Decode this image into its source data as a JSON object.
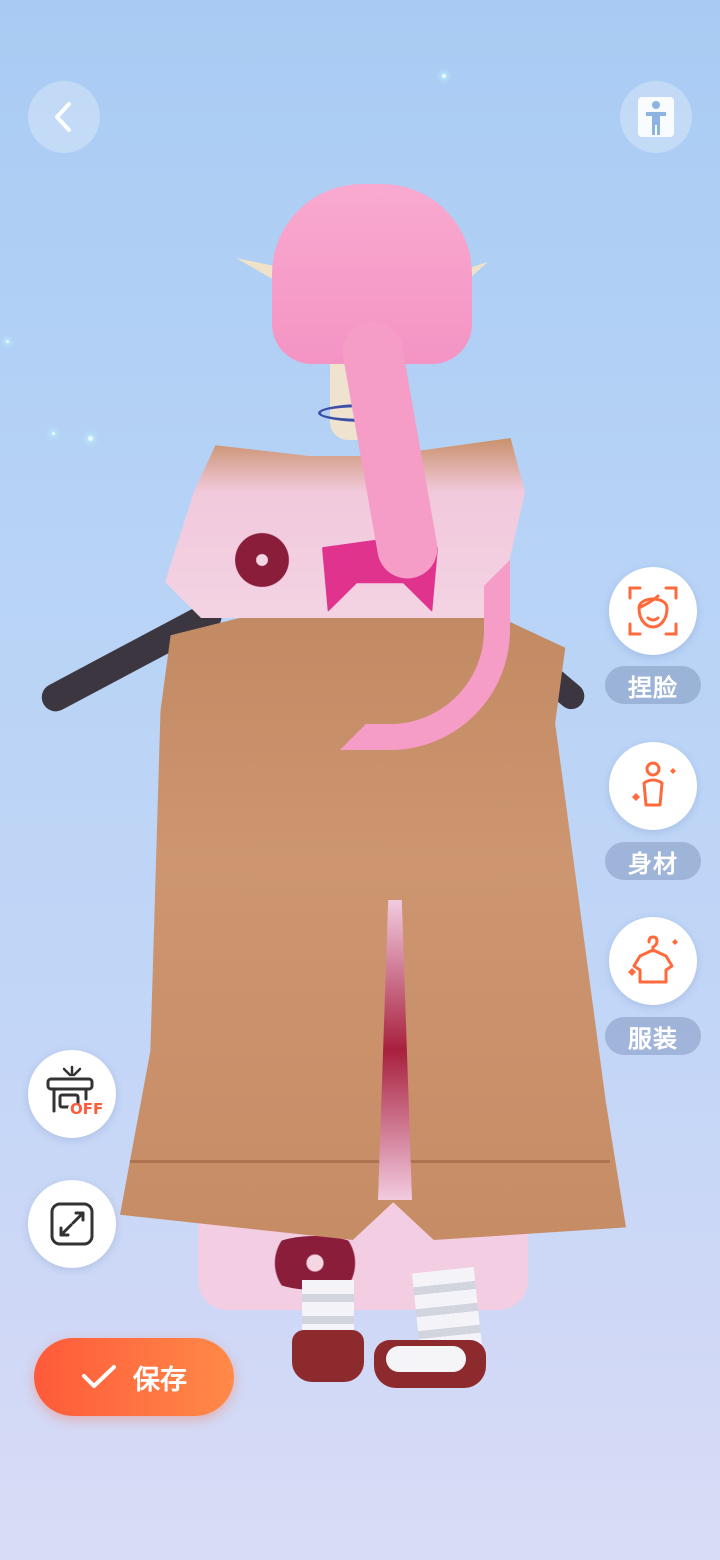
{
  "toolbar": {
    "back_icon": "chevron-left-icon",
    "body_view_icon": "standing-person-icon"
  },
  "side_menu": {
    "items": [
      {
        "label": "捏脸",
        "icon": "face-icon"
      },
      {
        "label": "身材",
        "icon": "body-icon"
      },
      {
        "label": "服装",
        "icon": "hanger-shirt-icon"
      }
    ]
  },
  "bottom_controls": {
    "stand_toggle_icon": "stand-off-icon",
    "stand_toggle_badge": "OFF",
    "fullscreen_icon": "expand-icon"
  },
  "save": {
    "label": "保存",
    "icon": "check-icon"
  },
  "colors": {
    "accent_orange": "#ff6a3d",
    "sky_top": "#a9cbf3",
    "sky_bottom": "#d9dcf6"
  }
}
